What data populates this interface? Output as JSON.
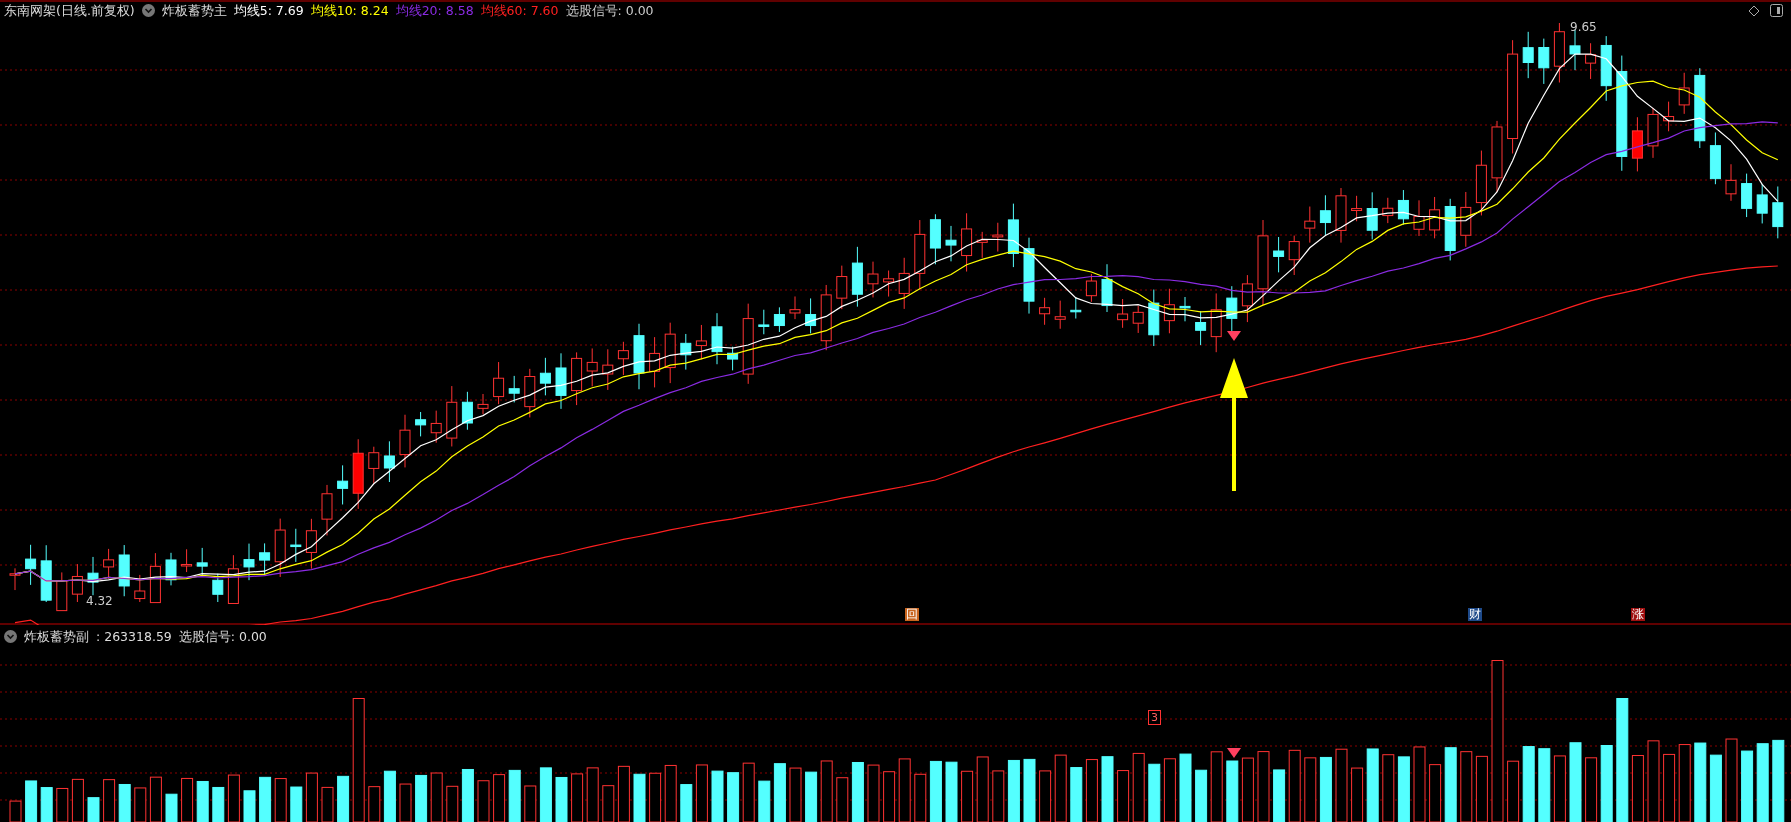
{
  "main_panel": {
    "title": "东南网架(日线.前复权)",
    "indicator": "炸板蓄势主",
    "legend": [
      {
        "label": "均线5: 7.69",
        "color": "#ffffff"
      },
      {
        "label": "均线10: 8.24",
        "color": "#ffff00"
      },
      {
        "label": "均线20: 8.58",
        "color": "#8a2be2"
      },
      {
        "label": "均线60: 7.60",
        "color": "#ff2020"
      },
      {
        "label": "选股信号: 0.00",
        "color": "#cccccc"
      }
    ],
    "high_label": "9.65",
    "low_label": "4.32",
    "event_markers": [
      {
        "text": "回",
        "color": "#c8641e"
      },
      {
        "text": "财",
        "color": "#1e4a8a"
      },
      {
        "text": "涨",
        "color": "#a01010"
      }
    ]
  },
  "sub_panel": {
    "indicator": "炸板蓄势副",
    "value": ": 263318.59",
    "signal": "选股信号: 0.00",
    "bar_label": "3"
  }
}
